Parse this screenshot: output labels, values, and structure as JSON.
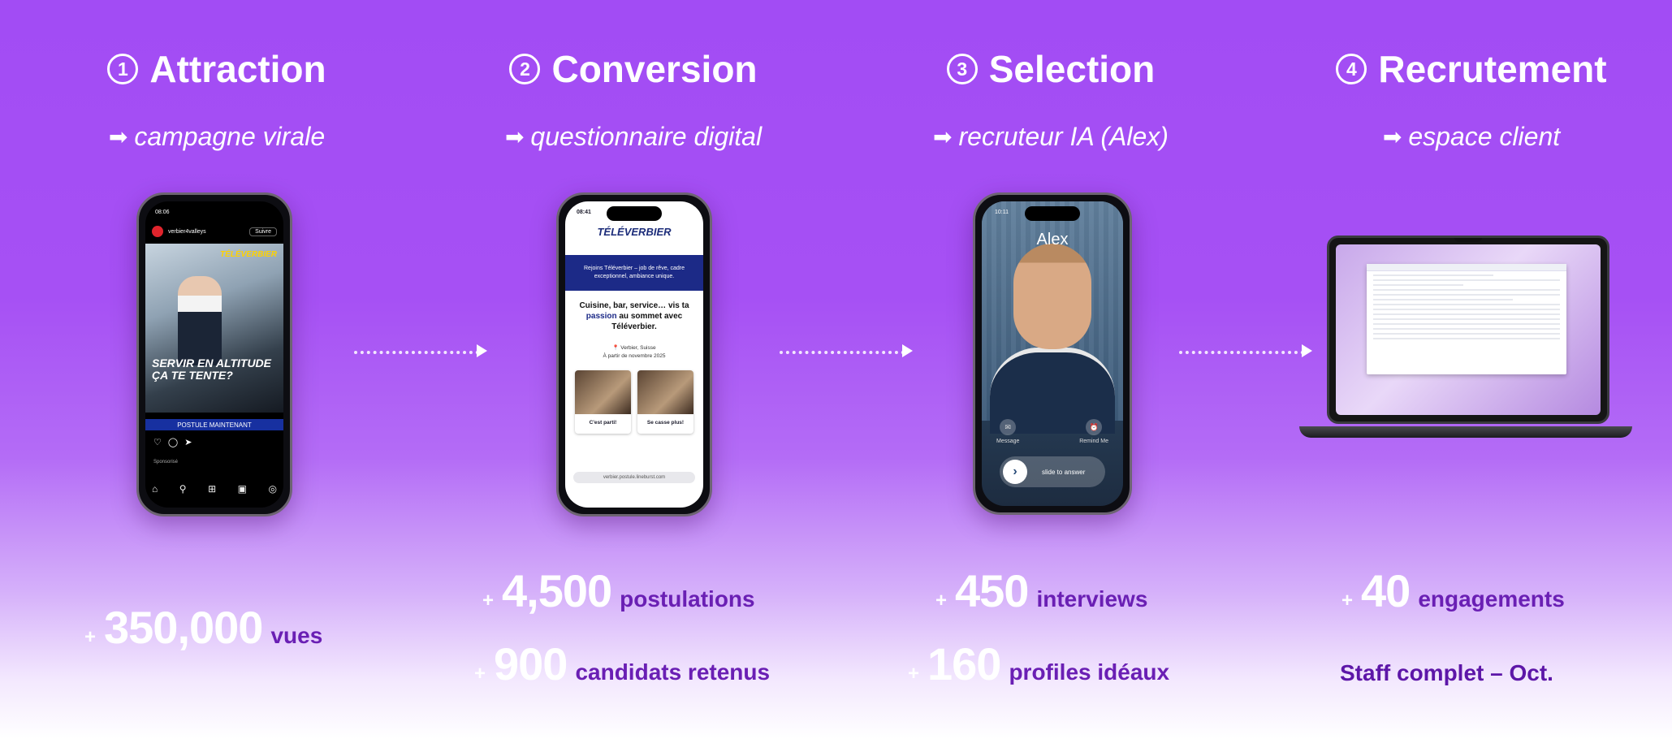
{
  "stages": [
    {
      "num": "1",
      "title": "Attraction",
      "arrow": "➡",
      "subtitle": "campagne virale"
    },
    {
      "num": "2",
      "title": "Conversion",
      "arrow": "➡",
      "subtitle": "questionnaire digital"
    },
    {
      "num": "3",
      "title": "Selection",
      "arrow": "➡",
      "subtitle": "recruteur IA (Alex)"
    },
    {
      "num": "4",
      "title": "Recrutement",
      "arrow": "➡",
      "subtitle": "espace client"
    }
  ],
  "stats": {
    "attraction": {
      "plus": "+",
      "value": "350,000",
      "unit": "vues"
    },
    "conversion_1": {
      "plus": "+",
      "value": "4,500",
      "unit": "postulations"
    },
    "conversion_2": {
      "plus": "+",
      "value": "900",
      "unit": "candidats retenus"
    },
    "selection_1": {
      "plus": "+",
      "value": "450",
      "unit": "interviews"
    },
    "selection_2": {
      "plus": "+",
      "value": "160",
      "unit": "profiles idéaux"
    },
    "recrutement_1": {
      "plus": "+",
      "value": "40",
      "unit": "engagements"
    },
    "recrutement_2": "Staff complet – Oct."
  },
  "instagram": {
    "time": "08:06",
    "account": "verbier4valleys",
    "follow": "Suivre",
    "brand": "TÉLÉVERBIER",
    "headline": "SERVIR EN ALTITUDE ÇA TE TENTE?",
    "cta": "POSTULE MAINTENANT",
    "sponsor": "Sponsorisé"
  },
  "questionnaire": {
    "time": "08:41",
    "logo": "TÉLÉVERBIER",
    "band": "Rejoins Téléverbier – job de rêve, cadre exceptionnel, ambiance unique.",
    "text_pre": "Cuisine, bar, service… vis ta ",
    "text_bold": "passion",
    "text_post": " au sommet avec Téléverbier.",
    "location": "📍 Verbier, Suisse",
    "date": "À partir de novembre 2025",
    "card1": "C'est parti!",
    "card2": "Se casse plus!",
    "url": "verbier.postule.lineburst.com"
  },
  "alex": {
    "time": "10:11",
    "name": "Alex",
    "message": "Message",
    "remind": "Remind Me",
    "slide": "slide to answer"
  },
  "colors": {
    "accent_text": "#6a1fb4",
    "bg_top": "#a24cf4",
    "ig_cta": "#1730a0",
    "tv_blue": "#1c2a87"
  }
}
